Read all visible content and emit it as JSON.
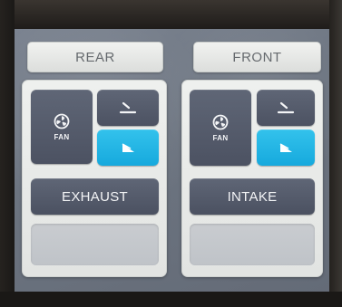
{
  "header": {
    "rear_label": "REAR",
    "front_label": "FRONT"
  },
  "rear": {
    "fan_label": "FAN",
    "fan_icon": "fan-icon",
    "up_icon": "vent-up-icon",
    "down_icon": "vent-down-icon",
    "down_active": true,
    "action_label": "EXHAUST"
  },
  "front": {
    "fan_label": "FAN",
    "fan_icon": "fan-icon",
    "up_icon": "vent-up-icon",
    "down_icon": "vent-down-icon",
    "down_active": true,
    "action_label": "INTAKE"
  },
  "colors": {
    "active": "#1fb3e4",
    "tile": "#565c6c",
    "panel": "#e8eae8",
    "screen": "#717985"
  }
}
